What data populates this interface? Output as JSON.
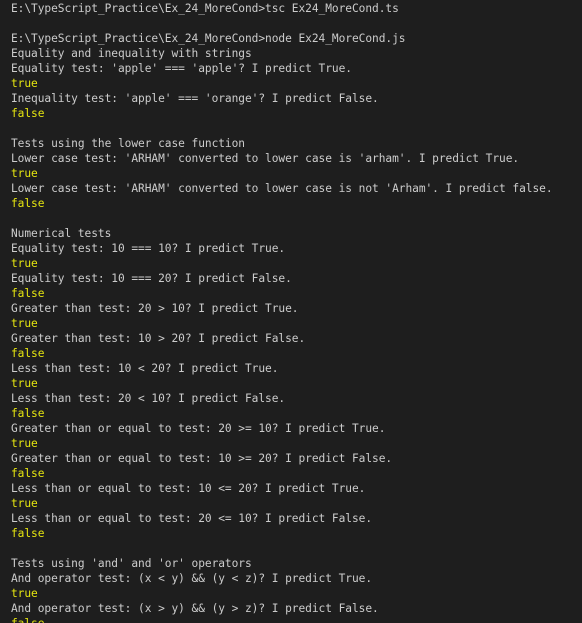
{
  "terminal": {
    "lines": [
      {
        "kind": "cmd",
        "text": "E:\\TypeScript_Practice\\Ex_24_MoreCond>tsc Ex24_MoreCond.ts"
      },
      {
        "kind": "blank",
        "text": ""
      },
      {
        "kind": "cmd",
        "text": "E:\\TypeScript_Practice\\Ex_24_MoreCond>node Ex24_MoreCond.js"
      },
      {
        "kind": "output",
        "text": "Equality and inequality with strings"
      },
      {
        "kind": "output",
        "text": "Equality test: 'apple' === 'apple'? I predict True."
      },
      {
        "kind": "true",
        "text": "true"
      },
      {
        "kind": "output",
        "text": "Inequality test: 'apple' === 'orange'? I predict False."
      },
      {
        "kind": "false",
        "text": "false"
      },
      {
        "kind": "blank",
        "text": ""
      },
      {
        "kind": "output",
        "text": "Tests using the lower case function"
      },
      {
        "kind": "output",
        "text": "Lower case test: 'ARHAM' converted to lower case is 'arham'. I predict True."
      },
      {
        "kind": "true",
        "text": "true"
      },
      {
        "kind": "output",
        "text": "Lower case test: 'ARHAM' converted to lower case is not 'Arham'. I predict false."
      },
      {
        "kind": "false",
        "text": "false"
      },
      {
        "kind": "blank",
        "text": ""
      },
      {
        "kind": "output",
        "text": "Numerical tests"
      },
      {
        "kind": "output",
        "text": "Equality test: 10 === 10? I predict True."
      },
      {
        "kind": "true",
        "text": "true"
      },
      {
        "kind": "output",
        "text": "Equality test: 10 === 20? I predict False."
      },
      {
        "kind": "false",
        "text": "false"
      },
      {
        "kind": "output",
        "text": "Greater than test: 20 > 10? I predict True."
      },
      {
        "kind": "true",
        "text": "true"
      },
      {
        "kind": "output",
        "text": "Greater than test: 10 > 20? I predict False."
      },
      {
        "kind": "false",
        "text": "false"
      },
      {
        "kind": "output",
        "text": "Less than test: 10 < 20? I predict True."
      },
      {
        "kind": "true",
        "text": "true"
      },
      {
        "kind": "output",
        "text": "Less than test: 20 < 10? I predict False."
      },
      {
        "kind": "false",
        "text": "false"
      },
      {
        "kind": "output",
        "text": "Greater than or equal to test: 20 >= 10? I predict True."
      },
      {
        "kind": "true",
        "text": "true"
      },
      {
        "kind": "output",
        "text": "Greater than or equal to test: 10 >= 20? I predict False."
      },
      {
        "kind": "false",
        "text": "false"
      },
      {
        "kind": "output",
        "text": "Less than or equal to test: 10 <= 20? I predict True."
      },
      {
        "kind": "true",
        "text": "true"
      },
      {
        "kind": "output",
        "text": "Less than or equal to test: 20 <= 10? I predict False."
      },
      {
        "kind": "false",
        "text": "false"
      },
      {
        "kind": "blank",
        "text": ""
      },
      {
        "kind": "output",
        "text": "Tests using 'and' and 'or' operators"
      },
      {
        "kind": "output",
        "text": "And operator test: (x < y) && (y < z)? I predict True."
      },
      {
        "kind": "true",
        "text": "true"
      },
      {
        "kind": "output",
        "text": "And operator test: (x > y) && (y > z)? I predict False."
      },
      {
        "kind": "false",
        "text": "false"
      }
    ]
  },
  "colors": {
    "background": "#1e1e1e",
    "text": "#cccccc",
    "boolean": "#e5e510"
  }
}
